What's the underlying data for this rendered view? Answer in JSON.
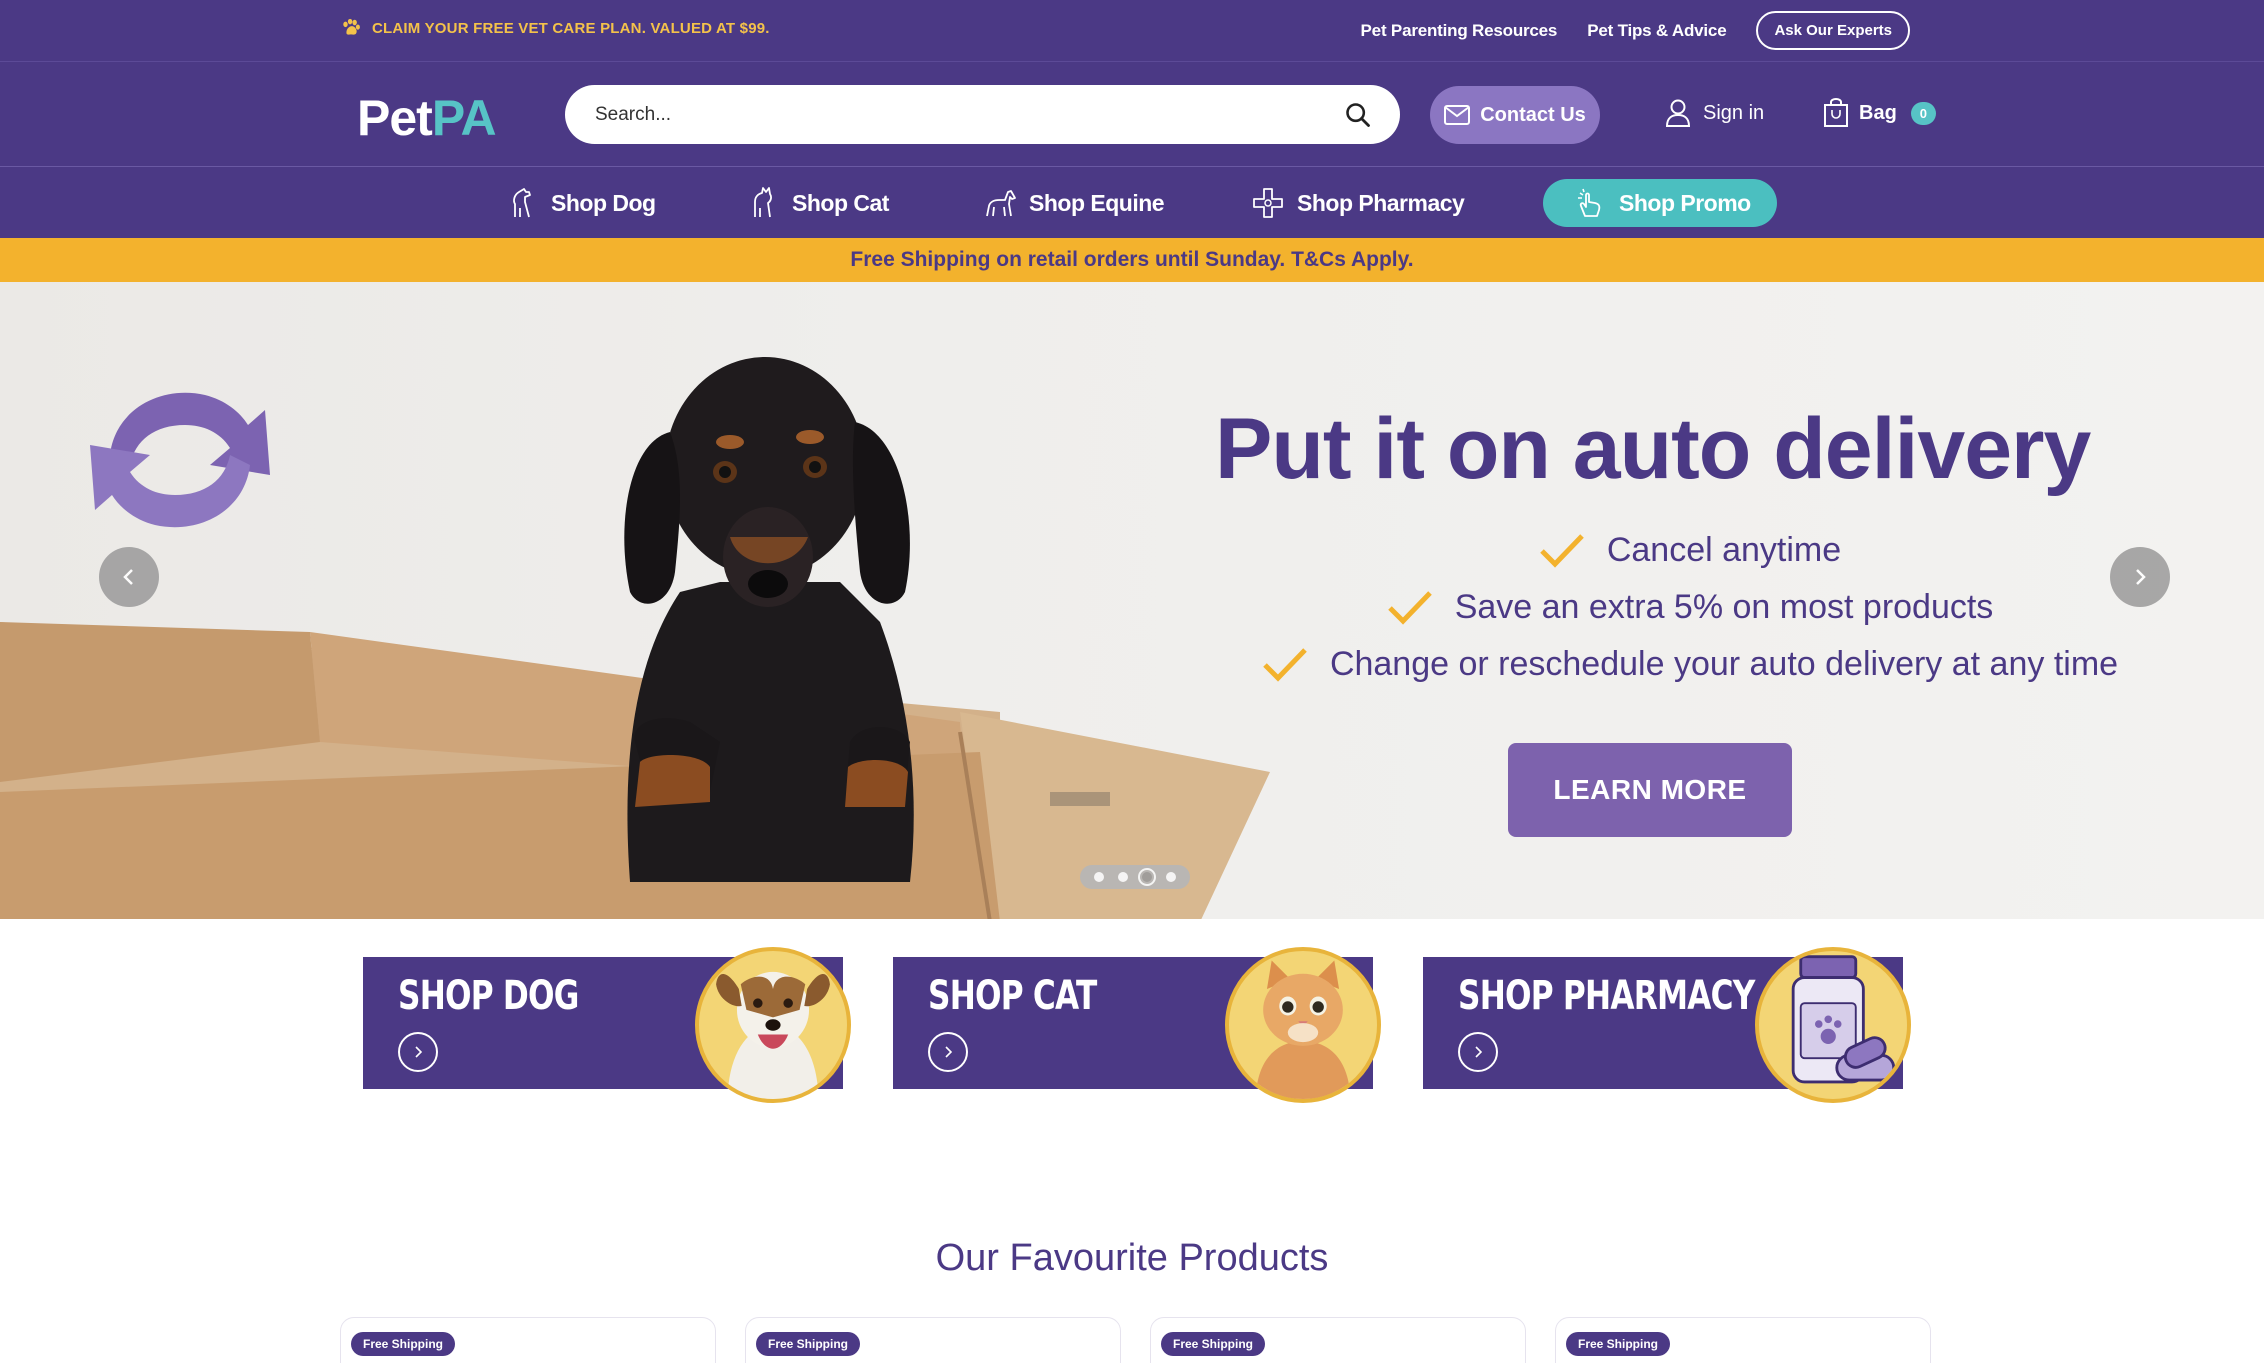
{
  "topbar": {
    "claim_text": "CLAIM YOUR FREE VET CARE PLAN. VALUED AT $99.",
    "links": [
      "Pet Parenting Resources",
      "Pet Tips & Advice"
    ],
    "experts_label": "Ask Our Experts"
  },
  "header": {
    "logo_pet": "Pet",
    "logo_pa": "PA",
    "search_placeholder": "Search...",
    "contact_label": "Contact Us",
    "signin_label": "Sign in",
    "bag_label": "Bag",
    "bag_count": "0"
  },
  "nav": {
    "dog": "Shop Dog",
    "cat": "Shop Cat",
    "equine": "Shop Equine",
    "pharmacy": "Shop Pharmacy",
    "promo": "Shop Promo"
  },
  "shipping_strip": "Free Shipping on retail orders until Sunday. T&Cs Apply.",
  "hero": {
    "title": "Put it on auto delivery",
    "bullets": [
      "Cancel anytime",
      "Save an extra 5% on most products",
      "Change or reschedule your auto delivery at any time"
    ],
    "cta": "LEARN MORE",
    "slides": 4,
    "active_slide": 3,
    "colors": {
      "accent": "#4b3985",
      "check": "#f3b22d",
      "button": "#7d62ad"
    }
  },
  "shop_cards": [
    {
      "title": "SHOP DOG",
      "icon": "dog-photo"
    },
    {
      "title": "SHOP CAT",
      "icon": "cat-photo"
    },
    {
      "title": "SHOP PHARMACY",
      "icon": "medicine-bottle-icon"
    }
  ],
  "favourites": {
    "title": "Our Favourite Products",
    "badges": [
      "Free Shipping",
      "Free Shipping",
      "Free Shipping",
      "Free Shipping"
    ]
  }
}
